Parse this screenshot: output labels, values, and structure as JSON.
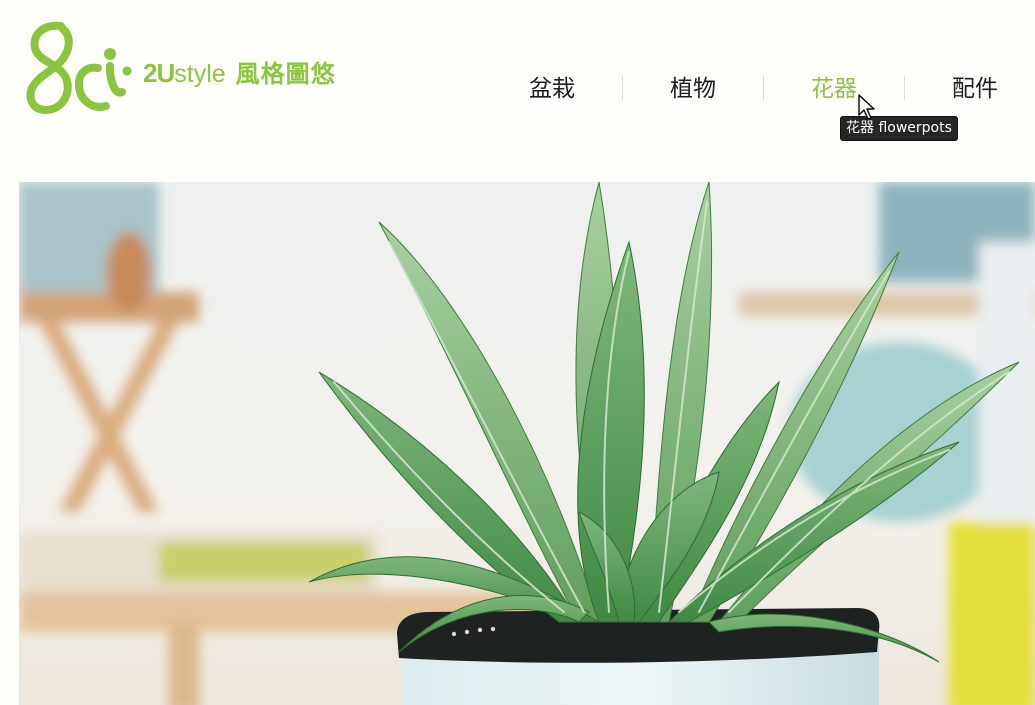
{
  "brand": {
    "number": "2U",
    "word": "style",
    "chinese": "風格圖悠",
    "color": "#8bc53f"
  },
  "nav": {
    "items": [
      {
        "label": "盆栽"
      },
      {
        "label": "植物"
      },
      {
        "label": "花器",
        "active": true
      },
      {
        "label": "配件"
      }
    ],
    "active_color": "#8bc53f"
  },
  "tooltip": {
    "text": "花器 flowerpots"
  },
  "hero": {
    "subject": "potted plant photo"
  }
}
